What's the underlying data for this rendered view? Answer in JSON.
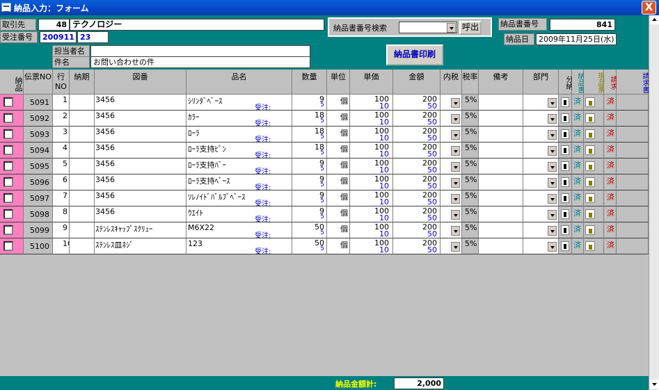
{
  "window": {
    "title": "納品入力：フォーム",
    "close_label": "X"
  },
  "header": {
    "customer_label": "取引先",
    "customer_code": "48",
    "customer_name": "テクノロジー",
    "order_no_label": "受注番号",
    "order_no_1": "200911",
    "order_no_2": "23",
    "contact_label": "担当者名",
    "contact_value": "",
    "subject_label": "件名",
    "subject_value": "お問い合わせの件",
    "search_label": "納品書番号検索",
    "search_value": "",
    "call_button": "呼出",
    "print_button": "納品書印刷",
    "delivery_no_label": "納品書番号",
    "delivery_no_value": "841",
    "delivery_date_label": "納品日",
    "delivery_date_value": "2009年11月25日(水)"
  },
  "columns": [
    "納品",
    "伝票NO",
    "行NO",
    "納期",
    "図番",
    "品名",
    "数量",
    "単位",
    "単価",
    "金額",
    "内税",
    "税率",
    "備考",
    "部門",
    "分納",
    "納品書",
    "現品票",
    "請求",
    "請求書"
  ],
  "rows": [
    {
      "no": "5091",
      "line": "1",
      "drawing": "3456",
      "name": "ｼﾘﾝﾀﾞﾍﾞｰｽ",
      "order_label": "受注:",
      "qty": "9",
      "qty2": "5",
      "unit": "個",
      "price": "100",
      "price2": "10",
      "amount": "200",
      "amount2": "50",
      "tax": "5%",
      "done1": "済",
      "done2": "済"
    },
    {
      "no": "5092",
      "line": "2",
      "drawing": "3456",
      "name": "ｶﾗｰ",
      "order_label": "受注:",
      "qty": "18",
      "qty2": "5",
      "unit": "個",
      "price": "100",
      "price2": "10",
      "amount": "200",
      "amount2": "50",
      "tax": "5%",
      "done1": "済",
      "done2": "済"
    },
    {
      "no": "5093",
      "line": "3",
      "drawing": "3456",
      "name": "ﾛｰﾗ",
      "order_label": "受注:",
      "qty": "18",
      "qty2": "5",
      "unit": "個",
      "price": "100",
      "price2": "10",
      "amount": "200",
      "amount2": "50",
      "tax": "5%",
      "done1": "済",
      "done2": "済"
    },
    {
      "no": "5094",
      "line": "4",
      "drawing": "3456",
      "name": "ﾛｰﾗ支持ﾋﾟﾝ",
      "order_label": "受注:",
      "qty": "18",
      "qty2": "5",
      "unit": "個",
      "price": "100",
      "price2": "10",
      "amount": "200",
      "amount2": "50",
      "tax": "5%",
      "done1": "済",
      "done2": "済"
    },
    {
      "no": "5095",
      "line": "5",
      "drawing": "3456",
      "name": "ﾛｰﾗ支持ﾊﾞｰ",
      "order_label": "受注:",
      "qty": "9",
      "qty2": "5",
      "unit": "個",
      "price": "100",
      "price2": "10",
      "amount": "200",
      "amount2": "50",
      "tax": "5%",
      "done1": "済",
      "done2": "済"
    },
    {
      "no": "5096",
      "line": "6",
      "drawing": "3456",
      "name": "ﾛｰﾗ支持ﾍﾞｰｽ",
      "order_label": "受注:",
      "qty": "9",
      "qty2": "5",
      "unit": "個",
      "price": "100",
      "price2": "10",
      "amount": "200",
      "amount2": "50",
      "tax": "5%",
      "done1": "済",
      "done2": "済"
    },
    {
      "no": "5097",
      "line": "7",
      "drawing": "3456",
      "name": "ｿﾚﾉｲﾄﾞﾊﾞﾙﾌﾞﾍﾞｰｽ",
      "order_label": "受注:",
      "qty": "9",
      "qty2": "5",
      "unit": "個",
      "price": "100",
      "price2": "10",
      "amount": "200",
      "amount2": "50",
      "tax": "5%",
      "done1": "済",
      "done2": "済"
    },
    {
      "no": "5098",
      "line": "8",
      "drawing": "3456",
      "name": "ｳｴｲﾄ",
      "order_label": "受注:",
      "qty": "9",
      "qty2": "5",
      "unit": "個",
      "price": "100",
      "price2": "10",
      "amount": "200",
      "amount2": "50",
      "tax": "5%",
      "done1": "済",
      "done2": "済"
    },
    {
      "no": "5099",
      "line": "9",
      "drawing": "ｽﾃﾝﾚｽｷｬｯﾌﾟｽｸﾘｭｰ",
      "name": "M6X22",
      "order_label": "受注:",
      "qty": "50",
      "qty2": "5",
      "unit": "個",
      "price": "100",
      "price2": "10",
      "amount": "200",
      "amount2": "50",
      "tax": "5%",
      "done1": "済",
      "done2": "済"
    },
    {
      "no": "5100",
      "line": "10",
      "drawing": "ｽﾃﾝﾚｽ皿ﾈｼﾞ",
      "name": "123",
      "order_label": "受注:",
      "qty": "50",
      "qty2": "5",
      "unit": "個",
      "price": "100",
      "price2": "10",
      "amount": "200",
      "amount2": "50",
      "tax": "5%",
      "done1": "済",
      "done2": "済"
    }
  ],
  "footer": {
    "total_label": "納品金額計:",
    "total_value": "2,000"
  },
  "colors": {
    "teal": "#008080",
    "form_gray": "#c0c0c0",
    "value_blue": "#0000c0",
    "pink": "#ff80c0"
  }
}
